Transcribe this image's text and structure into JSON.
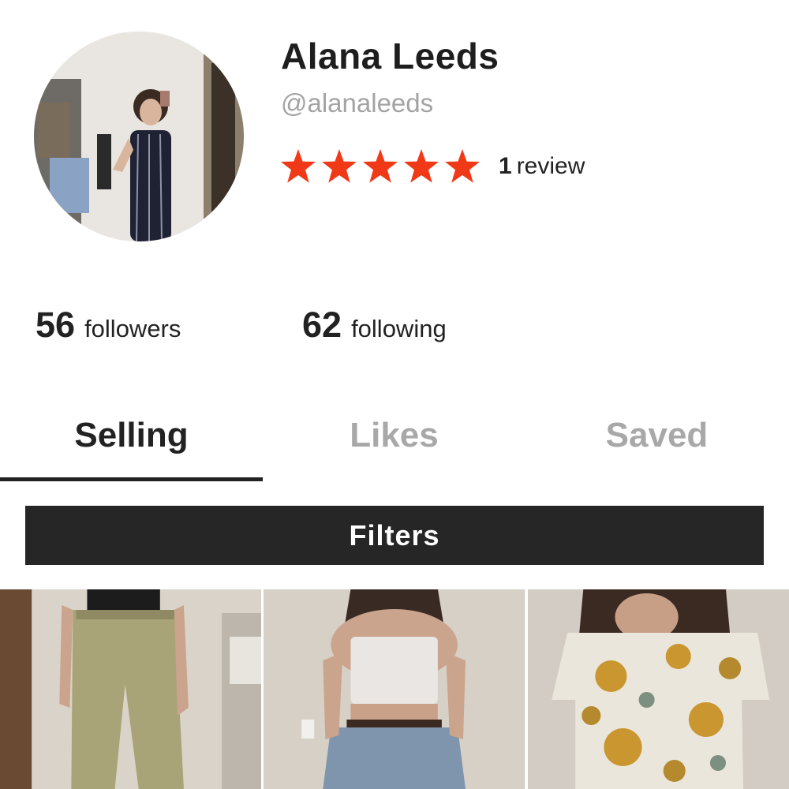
{
  "profile": {
    "name": "Alana Leeds",
    "handle": "@alanaleeds",
    "rating": {
      "stars": 5,
      "max_stars": 5,
      "star_color": "#f03a17",
      "review_count": "1",
      "review_label": "review"
    }
  },
  "stats": {
    "followers": {
      "count": "56",
      "label": "followers"
    },
    "following": {
      "count": "62",
      "label": "following"
    }
  },
  "tabs": [
    {
      "label": "Selling",
      "active": true
    },
    {
      "label": "Likes",
      "active": false
    },
    {
      "label": "Saved",
      "active": false
    }
  ],
  "filters": {
    "label": "Filters"
  },
  "listings": [
    {
      "image": "khaki-pants-photo"
    },
    {
      "image": "white-tube-top-photo"
    },
    {
      "image": "sunflower-blouse-photo"
    }
  ]
}
